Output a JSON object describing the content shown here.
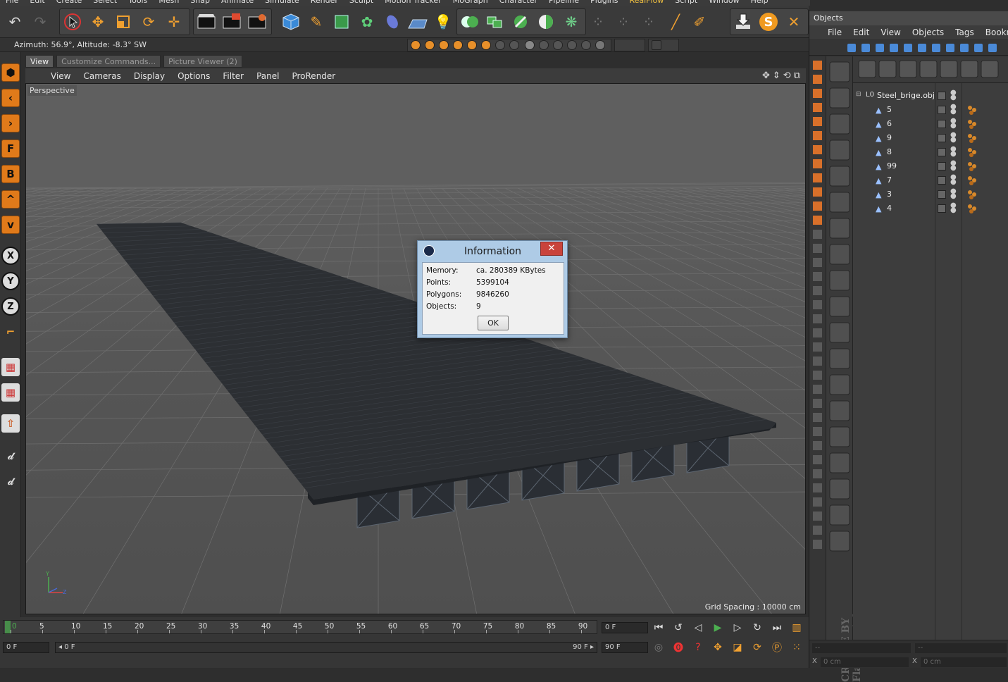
{
  "menu": [
    "File",
    "Edit",
    "Create",
    "Select",
    "Tools",
    "Mesh",
    "Snap",
    "Animate",
    "Simulate",
    "Render",
    "Sculpt",
    "Motion Tracker",
    "MoGraph",
    "Character",
    "Pipeline",
    "Plugins",
    "RealFlow",
    "Script",
    "Window",
    "Help"
  ],
  "status": {
    "azimuth": "Azimuth: 56.9°, Altitude: -8.3°  SW"
  },
  "tabs": [
    "View",
    "Customize Commands...",
    "Picture Viewer (2)"
  ],
  "viewport_menu": [
    "View",
    "Cameras",
    "Display",
    "Options",
    "Filter",
    "Panel",
    "ProRender"
  ],
  "viewport": {
    "label": "Perspective",
    "grid_spacing": "Grid Spacing : 10000 cm"
  },
  "left_toolbar_letters": [
    "F",
    "B",
    "X",
    "Y",
    "Z"
  ],
  "dialog": {
    "title": "Information",
    "close": "✕",
    "memory_label": "Memory:",
    "memory_value": "ca. 280389 KBytes",
    "points_label": "Points:",
    "points_value": "5399104",
    "polygons_label": "Polygons:",
    "polygons_value": "9846260",
    "objects_label": "Objects:",
    "objects_value": "9",
    "ok": "OK"
  },
  "timeline": {
    "ticks": [
      "0",
      "5",
      "10",
      "15",
      "20",
      "25",
      "30",
      "35",
      "40",
      "45",
      "50",
      "55",
      "60",
      "65",
      "70",
      "75",
      "80",
      "85",
      "90"
    ],
    "current_frame": "0 F",
    "start_frame": "0 F",
    "range_start": "◂ 0 F",
    "range_end": "90 F ▸",
    "end_frame": "90 F",
    "end_frame2": "90 F"
  },
  "objects_panel": {
    "title": "Objects",
    "menu": [
      "File",
      "Edit",
      "View",
      "Objects",
      "Tags",
      "Bookmarks"
    ],
    "root": "Steel_brige.obj",
    "children": [
      "5",
      "6",
      "9",
      "8",
      "99",
      "7",
      "3",
      "4"
    ],
    "credit": "CREATE BY Flamderwight",
    "coord_x1": "X",
    "coord_x1_val": "0 cm",
    "coord_x2": "X",
    "coord_x2_val": "0 cm"
  }
}
